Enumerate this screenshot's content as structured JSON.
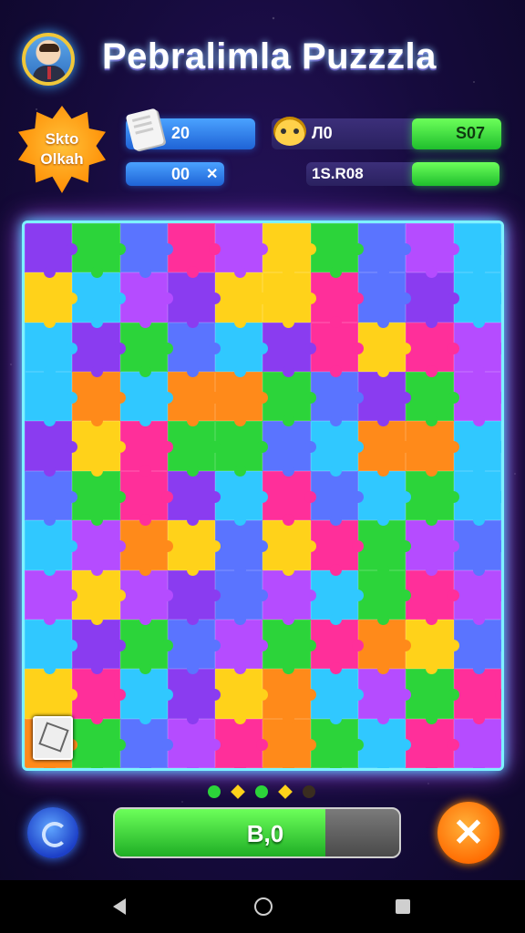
{
  "header": {
    "title": "Pebralimla Puzzzla",
    "badge_text": "Skto Olkah"
  },
  "stats": {
    "moves_value": "20",
    "secondary_value": "00",
    "secondary_symbol": "✕",
    "coins_value": "Л0",
    "score_value": "S07",
    "time_value": "1S.R08"
  },
  "progress": {
    "label": "B,0",
    "fill_fraction": 0.74
  },
  "page_indicator": [
    "green",
    "yellow",
    "green",
    "yellow",
    "dim"
  ],
  "close_label": "✕",
  "palette": [
    "#8a3cf0",
    "#30c8ff",
    "#ffd21a",
    "#2cd43a",
    "#ff8a1a",
    "#ff2f9a",
    "#5a74ff",
    "#b54cff"
  ],
  "board": {
    "rows": [
      [
        0,
        3,
        6,
        5,
        7,
        2,
        3,
        6,
        7,
        1
      ],
      [
        2,
        1,
        7,
        0,
        2,
        2,
        5,
        6,
        0,
        1
      ],
      [
        1,
        0,
        3,
        6,
        1,
        0,
        5,
        2,
        5,
        7
      ],
      [
        1,
        4,
        1,
        4,
        4,
        3,
        6,
        0,
        3,
        7
      ],
      [
        0,
        2,
        5,
        3,
        3,
        6,
        1,
        4,
        4,
        1
      ],
      [
        6,
        3,
        5,
        0,
        1,
        5,
        6,
        1,
        3,
        1
      ],
      [
        1,
        7,
        4,
        2,
        6,
        2,
        5,
        3,
        7,
        6
      ],
      [
        7,
        2,
        7,
        0,
        6,
        7,
        1,
        3,
        5,
        7
      ],
      [
        1,
        0,
        3,
        6,
        7,
        3,
        5,
        4,
        2,
        6
      ],
      [
        2,
        5,
        1,
        0,
        2,
        4,
        1,
        7,
        3,
        5
      ],
      [
        4,
        3,
        6,
        7,
        5,
        4,
        3,
        1,
        5,
        7
      ]
    ]
  }
}
